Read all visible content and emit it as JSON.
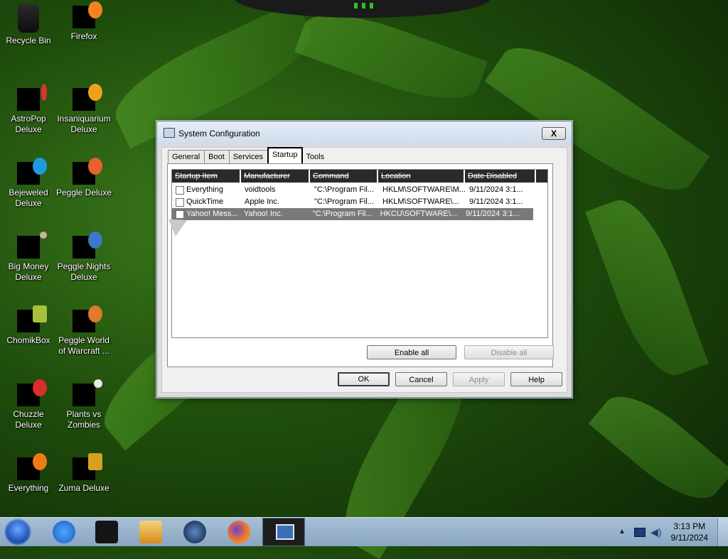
{
  "desktop": {
    "icons": [
      {
        "label": "Recycle Bin"
      },
      {
        "label": "Firefox"
      },
      {
        "label": "AstroPop Deluxe"
      },
      {
        "label": "Insaniquarium Deluxe"
      },
      {
        "label": "Bejeweled Deluxe"
      },
      {
        "label": "Peggle Deluxe"
      },
      {
        "label": "Big Money Deluxe"
      },
      {
        "label": "Peggle Nights Deluxe"
      },
      {
        "label": "ChomikBox"
      },
      {
        "label": "Peggle World of Warcraft ..."
      },
      {
        "label": "Chuzzle Deluxe"
      },
      {
        "label": "Plants vs Zombies"
      },
      {
        "label": "Everything"
      },
      {
        "label": "Zuma Deluxe"
      }
    ]
  },
  "dialog": {
    "title": "System Configuration",
    "close_label": "X",
    "tabs": [
      {
        "label": "General"
      },
      {
        "label": "Boot"
      },
      {
        "label": "Services"
      },
      {
        "label": "Startup"
      },
      {
        "label": "Tools"
      }
    ],
    "active_tab": "Startup",
    "columns": [
      "Startup Item",
      "Manufacturer",
      "Command",
      "Location",
      "Date Disabled"
    ],
    "rows": [
      {
        "item": "Everything",
        "manufacturer": "voidtools",
        "command": "\"C:\\Program Fil...",
        "location": "HKLM\\SOFTWARE\\M...",
        "date": "9/11/2024 3:1...",
        "checked": false
      },
      {
        "item": "QuickTime",
        "manufacturer": "Apple Inc.",
        "command": "\"C:\\Program Fil...",
        "location": "HKLM\\SOFTWARE\\...",
        "date": "9/11/2024 3:1...",
        "checked": false
      },
      {
        "item": "Yahoo! Mess...",
        "manufacturer": "Yahoo! Inc.",
        "command": "\"C:\\Program Fil...",
        "location": "HKCU\\SOFTWARE\\...",
        "date": "9/11/2024 3:1...",
        "checked": false
      }
    ],
    "buttons": {
      "enable_all": "Enable all",
      "disable_all": "Disable all",
      "ok": "OK",
      "cancel": "Cancel",
      "apply": "Apply",
      "help": "Help"
    }
  },
  "taskbar": {
    "clock_time": "3:13 PM",
    "clock_date": "9/11/2024"
  }
}
